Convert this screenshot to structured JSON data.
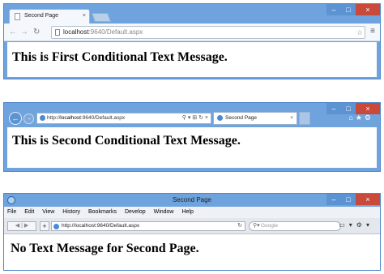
{
  "windows": [
    {
      "browser": "chrome",
      "tab_title": "Second Page",
      "tab_close": "×",
      "url_host": "localhost",
      "url_rest": ":9640/Default.aspx",
      "message": "This is First Conditional Text Message."
    },
    {
      "browser": "ie",
      "url": "http://localhost:9640/Default.aspx",
      "url_prefix": "http://",
      "url_host": "localhost",
      "url_rest": ":9640/Default.aspx",
      "tab_title": "Second Page",
      "tab_close": "×",
      "message": "This is Second Conditional Text Message."
    },
    {
      "browser": "safari",
      "window_title": "Second Page",
      "menu": [
        "File",
        "Edit",
        "View",
        "History",
        "Bookmarks",
        "Develop",
        "Window",
        "Help"
      ],
      "url": "http://localhost:9640/Default.aspx",
      "search_placeholder": "Google",
      "message": "No Text Message for Second Page."
    }
  ],
  "window_controls": {
    "minimize": "–",
    "maximize": "□",
    "close": "×"
  },
  "colors": {
    "frame": "#6fa3dd",
    "close": "#c9493b",
    "content": "#ffffff"
  }
}
